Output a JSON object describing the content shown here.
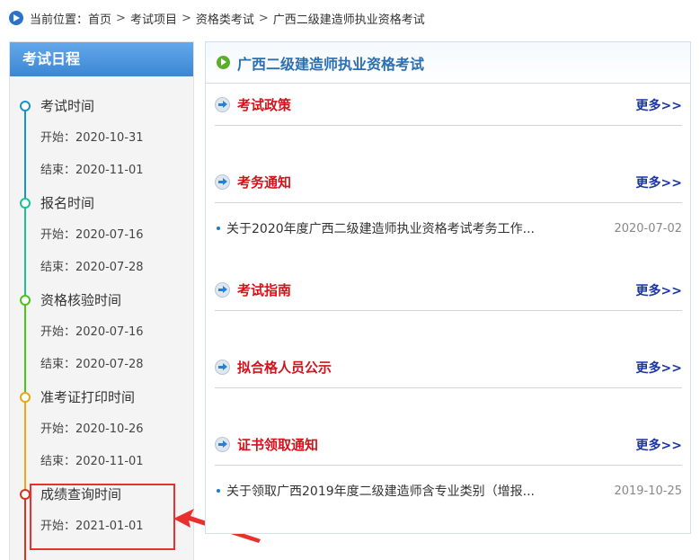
{
  "breadcrumb": {
    "prefix": "当前位置：",
    "items": [
      "首页",
      "考试项目",
      "资格类考试",
      "广西二级建造师执业资格考试"
    ],
    "separator": ">"
  },
  "sidebar": {
    "title": "考试日程",
    "groups": [
      {
        "title": "考试时间",
        "rows": [
          "开始：2020-10-31",
          "结束：2020-11-01"
        ],
        "color": "#1a93c9"
      },
      {
        "title": "报名时间",
        "rows": [
          "开始：2020-07-16",
          "结束：2020-07-28"
        ],
        "color": "#1fbf9a"
      },
      {
        "title": "资格核验时间",
        "rows": [
          "开始：2020-07-16",
          "结束：2020-07-28"
        ],
        "color": "#4ac41f"
      },
      {
        "title": "准考证打印时间",
        "rows": [
          "开始：2020-10-26",
          "结束：2020-11-01"
        ],
        "color": "#e6a817"
      },
      {
        "title": "成绩查询时间",
        "rows": [
          "开始：2021-01-01"
        ],
        "color": "#d9331f"
      }
    ]
  },
  "main": {
    "title": "广西二级建造师执业资格考试",
    "more_label": "更多>>",
    "sections": [
      {
        "title": "考试政策",
        "items": []
      },
      {
        "title": "考务通知",
        "items": [
          {
            "title": "关于2020年度广西二级建造师执业资格考试考务工作...",
            "date": "2020-07-02"
          }
        ]
      },
      {
        "title": "考试指南",
        "items": []
      },
      {
        "title": "拟合格人员公示",
        "items": []
      },
      {
        "title": "证书领取通知",
        "items": [
          {
            "title": "关于领取广西2019年度二级建造师含专业类别（增报...",
            "date": "2019-10-25"
          }
        ]
      }
    ]
  },
  "colors": {
    "accent_blue": "#2a73c7",
    "section_red": "#d4121a",
    "more_blue": "#1a35a8",
    "annotation_red": "#e8312e"
  }
}
